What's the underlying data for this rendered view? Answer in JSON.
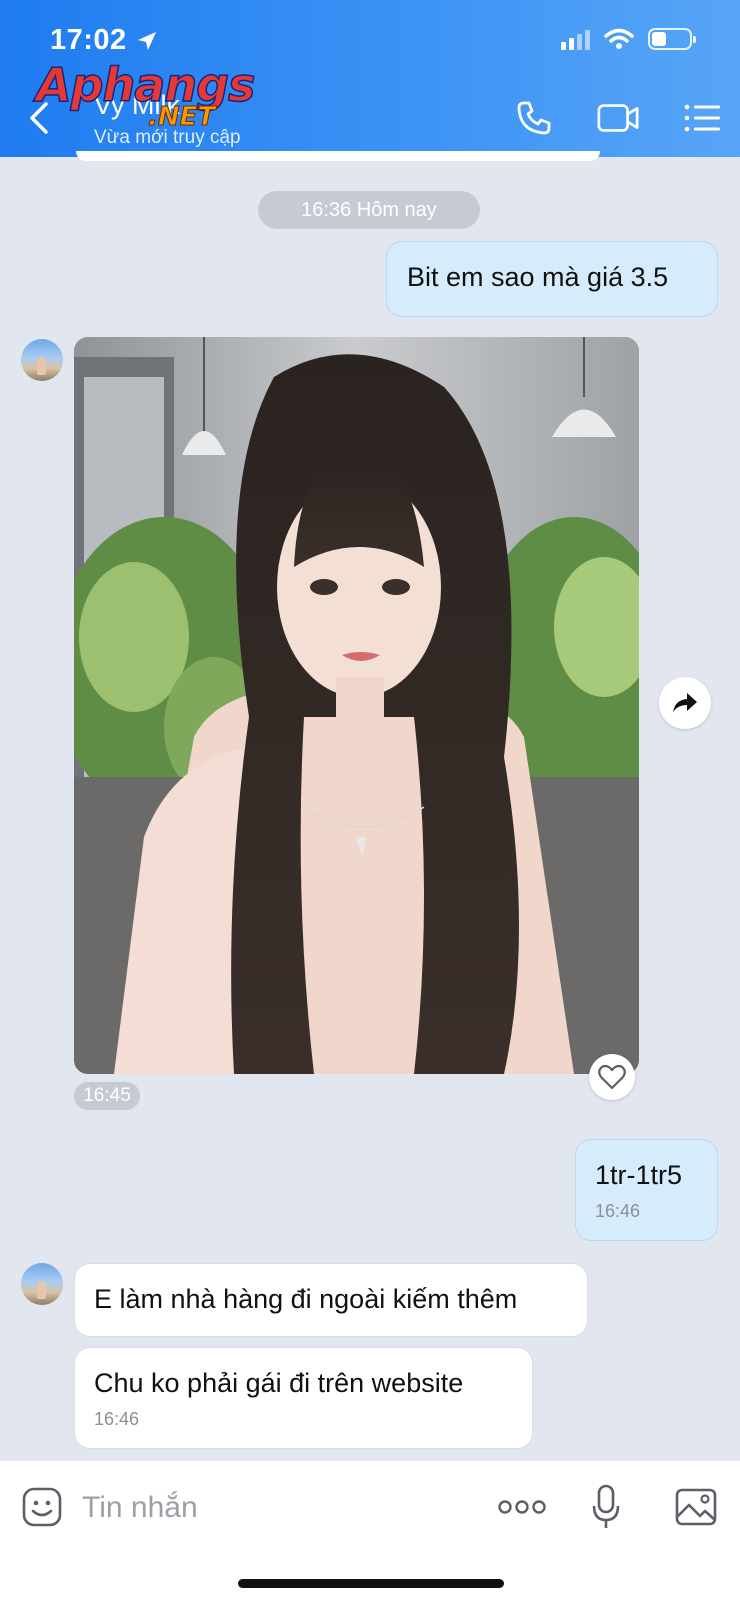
{
  "status_bar": {
    "time": "17:02"
  },
  "header": {
    "contact_name": "Vy Milk",
    "contact_status": "Vừa mới truy cập"
  },
  "watermark": {
    "main": "Aphangs",
    "suffix": ".NET"
  },
  "chat": {
    "date_separator": "16:36 Hôm nay",
    "messages": [
      {
        "direction": "out",
        "text": "Bit em sao mà giá 3.5"
      },
      {
        "direction": "in",
        "type": "photo",
        "time": "16:45"
      },
      {
        "direction": "out",
        "text": "1tr-1tr5",
        "time": "16:46"
      },
      {
        "direction": "in",
        "text": "E làm nhà hàng đi ngoài kiếm thêm"
      },
      {
        "direction": "in",
        "text": "Chu ko phải gái đi trên website",
        "time": "16:46"
      }
    ]
  },
  "input": {
    "placeholder": "Tin nhắn"
  },
  "icons": {
    "back": "chevron-left-icon",
    "call": "phone-icon",
    "video": "video-camera-icon",
    "menu": "list-menu-icon",
    "share": "share-arrow-icon",
    "like": "heart-icon",
    "sticker": "sticker-icon",
    "more": "more-dots-icon",
    "mic": "microphone-icon",
    "gallery": "image-icon"
  },
  "colors": {
    "header_gradient_start": "#1f7cf0",
    "header_gradient_end": "#57a5f7",
    "outgoing_bubble": "#d6ecfd",
    "incoming_bubble": "#ffffff",
    "chat_background": "#e2e6ef"
  }
}
